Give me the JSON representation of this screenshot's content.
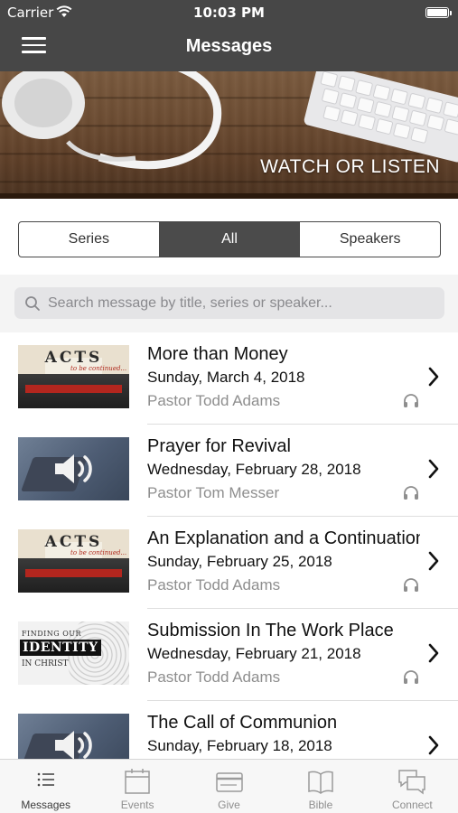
{
  "status_bar": {
    "carrier": "Carrier",
    "time": "10:03 PM"
  },
  "header": {
    "title": "Messages",
    "menu_icon": "hamburger-icon"
  },
  "banner": {
    "caption": "WATCH OR LISTEN"
  },
  "segments": [
    {
      "label": "Series",
      "active": false
    },
    {
      "label": "All",
      "active": true
    },
    {
      "label": "Speakers",
      "active": false
    }
  ],
  "search": {
    "placeholder": "Search message by title, series or speaker...",
    "value": ""
  },
  "messages": [
    {
      "title": "More than Money",
      "date": "Sunday, March 4, 2018",
      "speaker": "Pastor Todd Adams",
      "thumbnail": "acts"
    },
    {
      "title": "Prayer for Revival",
      "date": "Wednesday, February 28, 2018",
      "speaker": "Pastor Tom Messer",
      "thumbnail": "audio"
    },
    {
      "title": "An Explanation and a Continuation",
      "date": "Sunday, February 25, 2018",
      "speaker": "Pastor Todd Adams",
      "thumbnail": "acts"
    },
    {
      "title": "Submission In The Work Place",
      "date": "Wednesday, February 21, 2018",
      "speaker": "Pastor Todd Adams",
      "thumbnail": "identity"
    },
    {
      "title": "The Call of Communion",
      "date": "Sunday, February 18, 2018",
      "speaker": "",
      "thumbnail": "audio"
    }
  ],
  "thumbnail_text": {
    "acts": {
      "word": "ACTS",
      "sub": "to be continued..."
    },
    "identity": {
      "line1": "FINDING OUR",
      "line2": "IDENTITY",
      "line3": "IN CHRIST"
    }
  },
  "tabs": [
    {
      "label": "Messages",
      "icon": "list-icon",
      "active": true
    },
    {
      "label": "Events",
      "icon": "calendar-icon",
      "active": false
    },
    {
      "label": "Give",
      "icon": "card-icon",
      "active": false
    },
    {
      "label": "Bible",
      "icon": "book-icon",
      "active": false
    },
    {
      "label": "Connect",
      "icon": "chat-icon",
      "active": false
    }
  ],
  "colors": {
    "header_bg": "#474747",
    "active_segment": "#4b4b4b",
    "secondary_text": "#8e8e8e"
  }
}
